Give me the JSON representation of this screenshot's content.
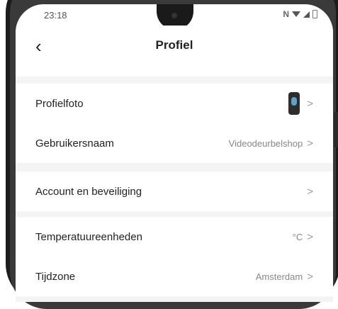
{
  "status_bar": {
    "time": "23:18",
    "nfc": "N"
  },
  "header": {
    "back_symbol": "‹",
    "title": "Profiel"
  },
  "sections": [
    {
      "rows": [
        {
          "label": "Profielfoto",
          "value": "",
          "chevron": ">"
        },
        {
          "label": "Gebruikersnaam",
          "value": "Videodeurbelshop",
          "chevron": ">"
        }
      ]
    },
    {
      "rows": [
        {
          "label": "Account en beveiliging",
          "value": "",
          "chevron": ">"
        }
      ]
    },
    {
      "rows": [
        {
          "label": "Temperatuureenheden",
          "value": "°C",
          "chevron": ">"
        },
        {
          "label": "Tijdzone",
          "value": "Amsterdam",
          "chevron": ">"
        }
      ]
    }
  ],
  "colors": {
    "background": "#f4f4f4",
    "surface": "#ffffff",
    "text": "#222222",
    "muted": "#888888"
  }
}
